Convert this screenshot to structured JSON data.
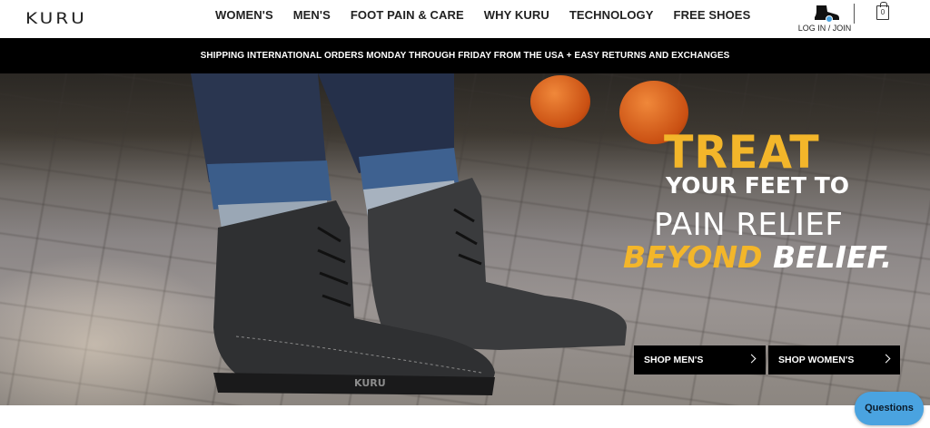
{
  "brand": {
    "logo_letters": [
      "K",
      "U",
      "R",
      "U"
    ],
    "logo_text": "KURU"
  },
  "nav": {
    "items": [
      {
        "label": "WOMEN'S"
      },
      {
        "label": "MEN'S"
      },
      {
        "label": "FOOT PAIN & CARE"
      },
      {
        "label": "WHY KURU"
      },
      {
        "label": "TECHNOLOGY"
      },
      {
        "label": "FREE SHOES"
      }
    ],
    "login_label": "LOG IN / JOIN",
    "login_icon": "shoe-account-icon",
    "cart_icon": "shopping-bag-icon",
    "cart_count": "0"
  },
  "announcement": "SHIPPING INTERNATIONAL ORDERS MONDAY THROUGH FRIDAY FROM THE USA + EASY RETURNS AND EXCHANGES",
  "hero": {
    "line1": "TREAT",
    "line2": "YOUR FEET TO",
    "line3": "PAIN RELIEF",
    "line4_accent": "BEYOND",
    "line4_rest": "BELIEF.",
    "boot_brand": "KURU",
    "buttons": {
      "men": "SHOP MEN'S",
      "women": "SHOP WOMEN'S"
    }
  },
  "chat": {
    "label": "Questions"
  },
  "colors": {
    "accent_yellow": "#f3b62a",
    "announce_bg": "#000000",
    "chat_blue": "#4aa3e0",
    "button_bg": "#000000"
  }
}
